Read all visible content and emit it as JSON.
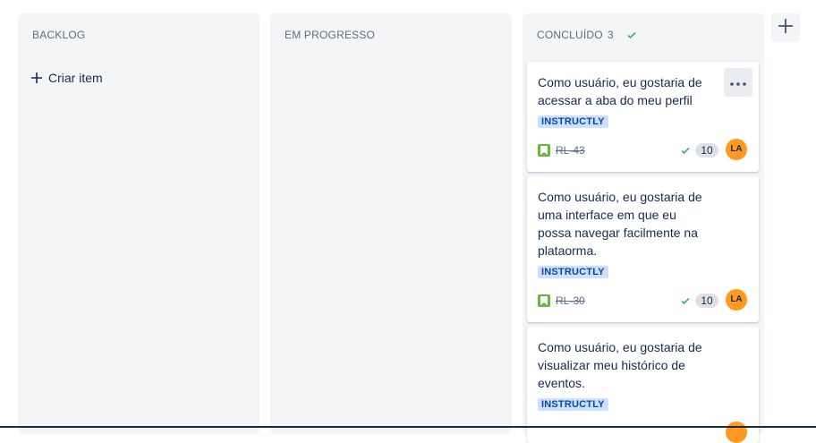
{
  "columns": [
    {
      "title": "BACKLOG",
      "count": "",
      "create_label": "Criar item"
    },
    {
      "title": "EM PROGRESSO",
      "count": ""
    },
    {
      "title": "CONCLUÍDO",
      "count": "3"
    }
  ],
  "cards": [
    {
      "title": "Como usuário, eu gostaria de acessar a aba do meu perfil",
      "tag": "INSTRUCTLY",
      "key": "RL-43",
      "points": "10",
      "assignee_initials": "LA"
    },
    {
      "title": "Como usuário, eu gostaria de uma interface em que eu possa navegar facilmente na plataorma.",
      "tag": "INSTRUCTLY",
      "key": "RL-30",
      "points": "10",
      "assignee_initials": "LA"
    },
    {
      "title": "Como usuário, eu gostaria de visualizar meu histórico de eventos.",
      "tag": "INSTRUCTLY",
      "key": "",
      "points": "",
      "assignee_initials": ""
    }
  ],
  "icons": {
    "create": "plus-icon",
    "done": "check-icon",
    "more": "more-horizontal-icon",
    "story": "story-bookmark-icon",
    "add_column": "plus-icon"
  },
  "colors": {
    "column_bg": "#f4f5f7",
    "tag_bg": "#cce0ff",
    "tag_text": "#0747a6",
    "done_check": "#36b37e",
    "story_icon": "#63ba3c",
    "avatar": "#ff991f"
  }
}
